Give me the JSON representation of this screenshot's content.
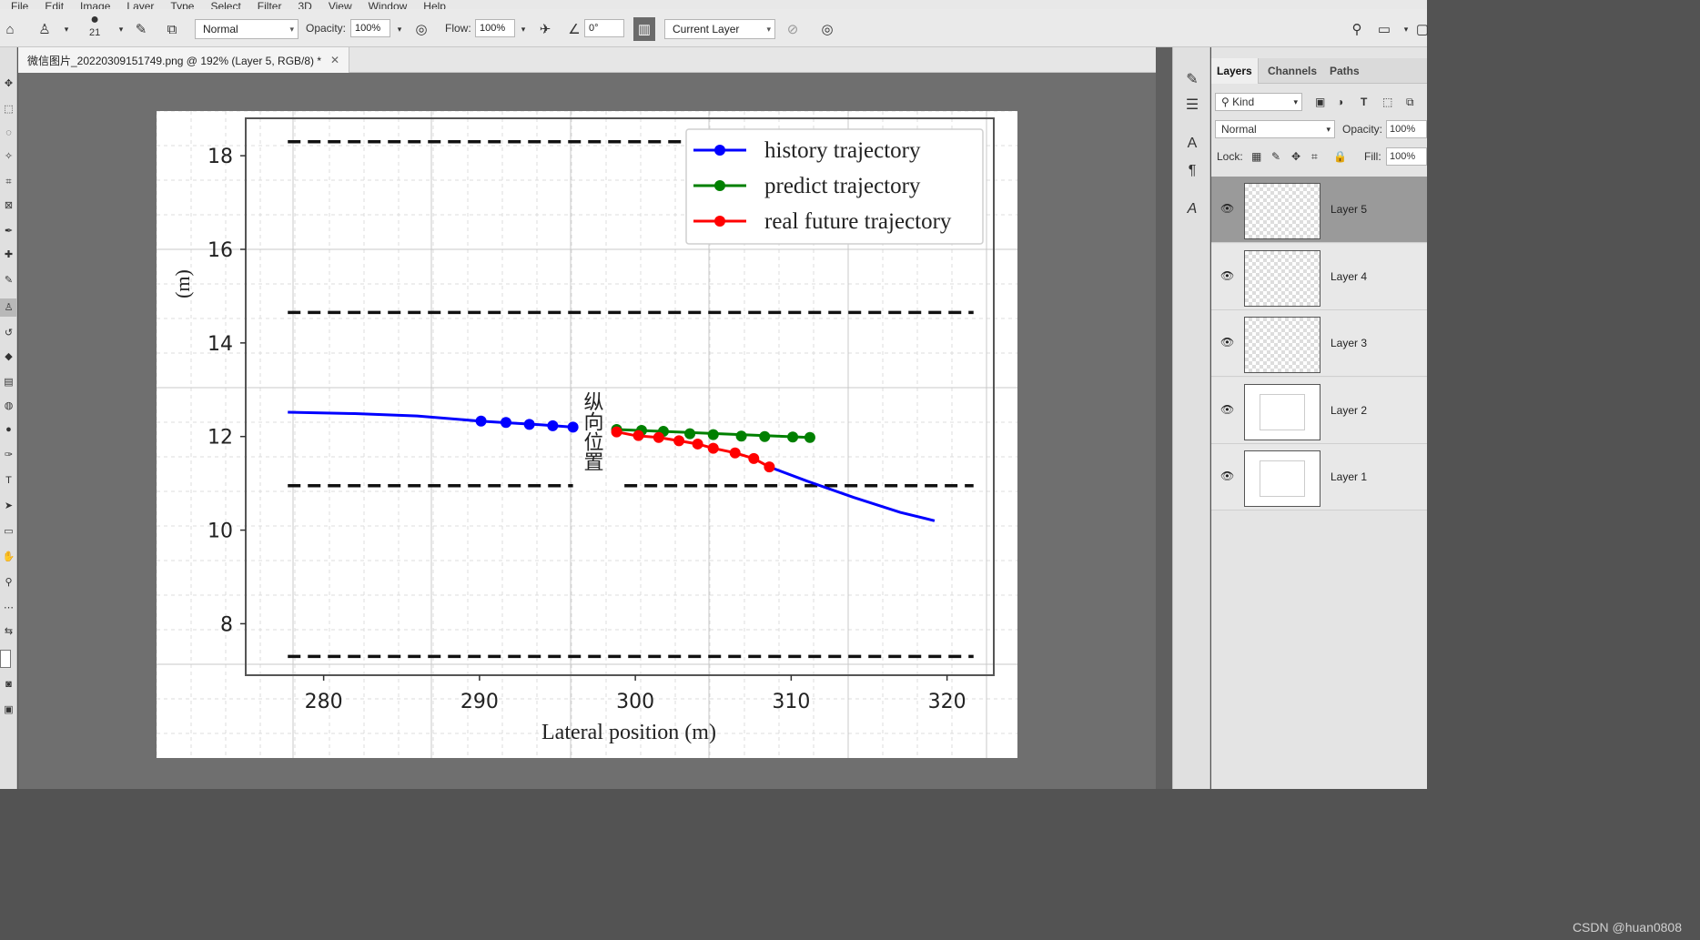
{
  "menubar": {
    "items": [
      "File",
      "Edit",
      "Image",
      "Layer",
      "Type",
      "Select",
      "Filter",
      "3D",
      "View",
      "Window",
      "Help"
    ]
  },
  "options": {
    "brush_size": "21",
    "mode": "Normal",
    "opacity_label": "Opacity:",
    "opacity_value": "100%",
    "flow_label": "Flow:",
    "flow_value": "100%",
    "angle_value": "0°",
    "sample": "Current Layer"
  },
  "document": {
    "tab_title": "微信图片_20220309151749.png @ 192% (Layer 5, RGB/8) *"
  },
  "panel": {
    "tabs": [
      "Layers",
      "Channels",
      "Paths"
    ],
    "kind_label": "Kind",
    "blend_mode": "Normal",
    "opacity_label": "Opacity:",
    "opacity_value": "100%",
    "lock_label": "Lock:",
    "fill_label": "Fill:",
    "fill_value": "100%",
    "layers": [
      {
        "name": "Layer 5",
        "selected": true
      },
      {
        "name": "Layer 4",
        "selected": false
      },
      {
        "name": "Layer 3",
        "selected": false
      },
      {
        "name": "Layer 2",
        "selected": false
      },
      {
        "name": "Layer 1",
        "selected": false
      }
    ]
  },
  "watermark": "CSDN @huan0808",
  "chart_data": {
    "type": "line",
    "xlabel": "Lateral position (m)",
    "ylabel": "(m)",
    "overlay_text": "纵向位置",
    "xlim": [
      275,
      323
    ],
    "ylim": [
      6.9,
      18.8
    ],
    "xticks": [
      280,
      290,
      300,
      310,
      320
    ],
    "yticks": [
      8,
      10,
      12,
      14,
      16,
      18
    ],
    "grid": true,
    "legend_position": "top-right",
    "lane_lines": [
      18.3,
      14.65,
      10.95,
      7.3
    ],
    "series": [
      {
        "name": "history trajectory",
        "color": "#0000ff",
        "line": [
          [
            277.7,
            12.52
          ],
          [
            282,
            12.49
          ],
          [
            286,
            12.44
          ],
          [
            290,
            12.33
          ],
          [
            294,
            12.25
          ],
          [
            296,
            12.2
          ]
        ],
        "markers": [
          [
            290.1,
            12.33
          ],
          [
            291.7,
            12.3
          ],
          [
            293.2,
            12.26
          ],
          [
            294.7,
            12.23
          ],
          [
            296,
            12.2
          ]
        ]
      },
      {
        "name": "predict trajectory",
        "color": "#008000",
        "line": [
          [
            298.8,
            12.15
          ],
          [
            311.2,
            11.98
          ]
        ],
        "markers": [
          [
            298.8,
            12.15
          ],
          [
            300.4,
            12.13
          ],
          [
            301.8,
            12.11
          ],
          [
            303.5,
            12.06
          ],
          [
            305,
            12.04
          ],
          [
            306.8,
            12.01
          ],
          [
            308.3,
            12.0
          ],
          [
            310.1,
            11.99
          ],
          [
            311.2,
            11.98
          ]
        ]
      },
      {
        "name": "real future trajectory",
        "color": "#ff0000",
        "line": [
          [
            298.8,
            12.1
          ],
          [
            300,
            12.02
          ],
          [
            301.5,
            11.98
          ],
          [
            302.8,
            11.91
          ],
          [
            304,
            11.84
          ],
          [
            305,
            11.75
          ],
          [
            306.4,
            11.65
          ],
          [
            307.6,
            11.53
          ],
          [
            308.6,
            11.35
          ]
        ],
        "markers": [
          [
            298.8,
            12.1
          ],
          [
            300.2,
            12.02
          ],
          [
            301.5,
            11.98
          ],
          [
            302.8,
            11.91
          ],
          [
            304,
            11.84
          ],
          [
            305,
            11.75
          ],
          [
            306.4,
            11.65
          ],
          [
            307.6,
            11.53
          ],
          [
            308.6,
            11.35
          ]
        ],
        "continuation": [
          [
            308.6,
            11.35
          ],
          [
            311,
            11.05
          ],
          [
            314,
            10.7
          ],
          [
            317,
            10.38
          ],
          [
            319.2,
            10.2
          ]
        ]
      }
    ]
  }
}
